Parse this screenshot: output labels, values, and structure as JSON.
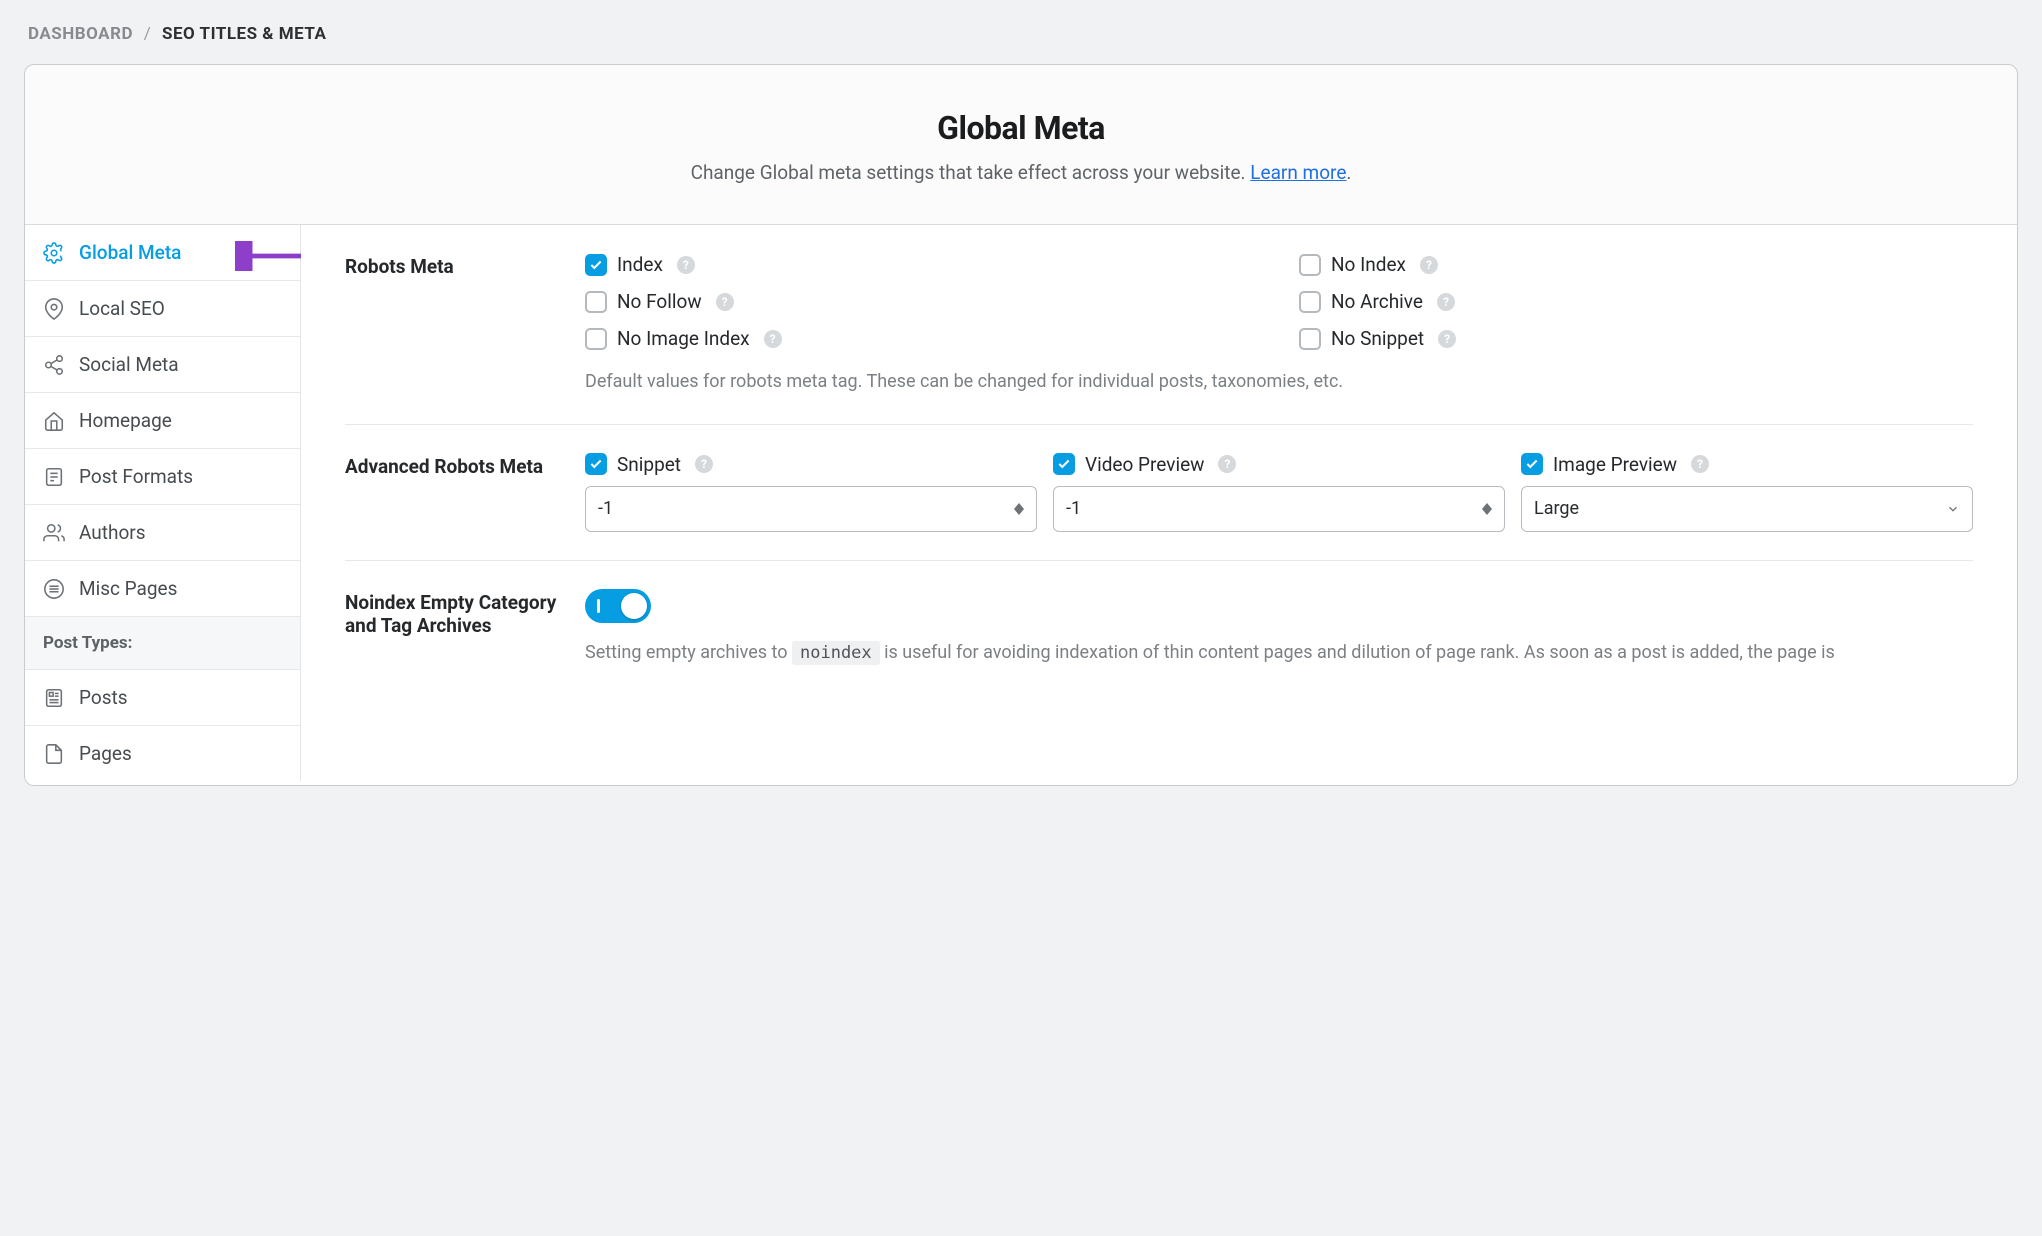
{
  "breadcrumb": {
    "dashboard": "DASHBOARD",
    "current": "SEO TITLES & META"
  },
  "header": {
    "title": "Global Meta",
    "desc": "Change Global meta settings that take effect across your website. ",
    "learn": "Learn more",
    "period": "."
  },
  "sidebar": {
    "items": [
      {
        "label": "Global Meta"
      },
      {
        "label": "Local SEO"
      },
      {
        "label": "Social Meta"
      },
      {
        "label": "Homepage"
      },
      {
        "label": "Post Formats"
      },
      {
        "label": "Authors"
      },
      {
        "label": "Misc Pages"
      }
    ],
    "group": "Post Types:",
    "post_types": [
      {
        "label": "Posts"
      },
      {
        "label": "Pages"
      }
    ]
  },
  "robots": {
    "label": "Robots Meta",
    "opts": {
      "index": "Index",
      "noindex": "No Index",
      "nofollow": "No Follow",
      "noarchive": "No Archive",
      "noimage": "No Image Index",
      "nosnippet": "No Snippet"
    },
    "hint": "Default values for robots meta tag. These can be changed for individual posts, taxonomies, etc."
  },
  "adv": {
    "label": "Advanced Robots Meta",
    "snippet": {
      "label": "Snippet",
      "value": "-1"
    },
    "video": {
      "label": "Video Preview",
      "value": "-1"
    },
    "image": {
      "label": "Image Preview",
      "value": "Large"
    }
  },
  "noindex": {
    "label": "Noindex Empty Category and Tag Archives",
    "on": true,
    "note1": "Setting empty archives to ",
    "code": "noindex",
    "note2": " is useful for avoiding indexation of thin content pages and dilution of page rank. As soon as a post is added, the page is"
  },
  "icons": {
    "help": "?"
  }
}
